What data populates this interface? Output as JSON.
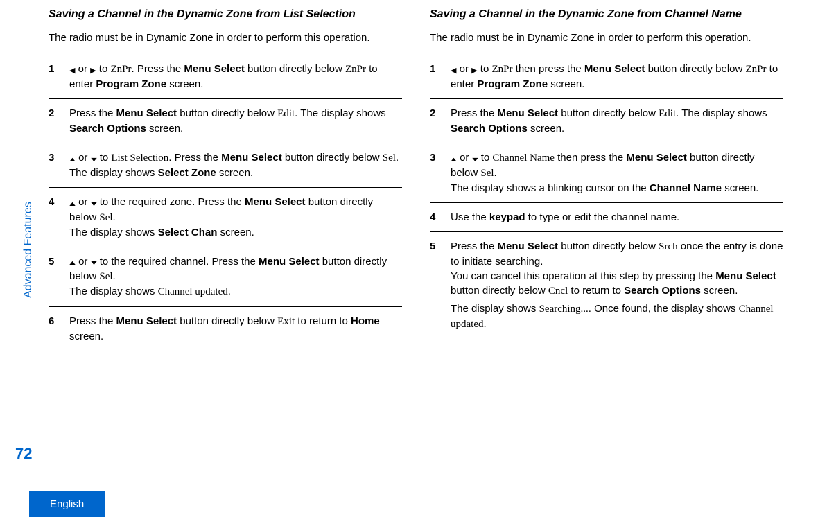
{
  "sidebar": {
    "section_label": "Advanced Features",
    "page_number": "72",
    "language": "English"
  },
  "left": {
    "title": "Saving a Channel in the Dynamic Zone from List Selection",
    "intro": "The radio must be in Dynamic Zone in order to perform this operation.",
    "steps": {
      "s1": {
        "num": "1",
        "html": "<span class='icon arrow-left' data-name='nav-left-icon' data-interactable='false'></span> or <span class='icon arrow-right' data-name='nav-right-icon' data-interactable='false'></span> to <span class='soft'>ZnPr</span>. Press the <span class='b'>Menu Select</span> button directly below <span class='soft'>ZnPr</span> to enter <span class='b'>Program Zone</span> screen."
      },
      "s2": {
        "num": "2",
        "html": "Press the <span class='b'>Menu Select</span> button directly below <span class='soft'>Edit</span>. The display shows <span class='b'>Search Options</span> screen."
      },
      "s3": {
        "num": "3",
        "html": "<span class='icon arrow-up' data-name='nav-up-icon' data-interactable='false'></span> or <span class='icon arrow-down' data-name='nav-down-icon' data-interactable='false'></span> to <span class='soft'>List Selection</span>. Press the <span class='b'>Menu Select</span> button directly below <span class='soft'>Sel</span>.<br>The display shows <span class='b'>Select Zone</span> screen."
      },
      "s4": {
        "num": "4",
        "html": "<span class='icon arrow-up' data-name='nav-up-icon' data-interactable='false'></span> or <span class='icon arrow-down' data-name='nav-down-icon' data-interactable='false'></span> to the required zone. Press the <span class='b'>Menu Select</span> button directly below <span class='soft'>Sel</span>.<br>The display shows <span class='b'>Select Chan</span> screen."
      },
      "s5": {
        "num": "5",
        "html": "<span class='icon arrow-up' data-name='nav-up-icon' data-interactable='false'></span> or <span class='icon arrow-down' data-name='nav-down-icon' data-interactable='false'></span> to the required channel. Press the <span class='b'>Menu Select</span> button directly below <span class='soft'>Sel</span>.<br>The display shows <span class='soft'>Channel updated</span>."
      },
      "s6": {
        "num": "6",
        "html": "Press the <span class='b'>Menu Select</span> button directly below <span class='soft'>Exit</span> to return to <span class='b'>Home</span> screen."
      }
    }
  },
  "right": {
    "title": "Saving a Channel in the Dynamic Zone from Channel Name",
    "intro": "The radio must be in Dynamic Zone in order to perform this operation.",
    "steps": {
      "s1": {
        "num": "1",
        "html": "<span class='icon arrow-left' data-name='nav-left-icon' data-interactable='false'></span> or <span class='icon arrow-right' data-name='nav-right-icon' data-interactable='false'></span> to <span class='soft'>ZnPr</span> then press the <span class='b'>Menu Select</span> button directly below <span class='soft'>ZnPr</span> to enter <span class='b'>Program Zone</span> screen."
      },
      "s2": {
        "num": "2",
        "html": "Press the <span class='b'>Menu Select</span> button directly below <span class='soft'>Edit</span>. The display shows <span class='b'>Search Options</span> screen."
      },
      "s3": {
        "num": "3",
        "html": "<span class='icon arrow-up' data-name='nav-up-icon' data-interactable='false'></span> or <span class='icon arrow-down' data-name='nav-down-icon' data-interactable='false'></span> to <span class='soft'>Channel Name</span> then press the <span class='b'>Menu Select</span> button directly below <span class='soft'>Sel</span>.<br>The display shows a blinking cursor on the <span class='b'>Channel Name</span> screen."
      },
      "s4": {
        "num": "4",
        "html": "Use the <span class='b'>keypad</span> to type or edit the channel name."
      },
      "s5": {
        "num": "5",
        "html": "Press the <span class='b'>Menu Select</span> button directly below <span class='soft'>Srch</span> once the entry is done to initiate searching.<p>You can cancel this operation at this step by pressing the <span class='b'>Menu Select</span> button directly below <span class='soft'>Cncl</span> to return to <span class='b'>Search Options</span> screen.</p><p>The display shows <span class='soft'>Searching...</span>. Once found, the display shows <span class='soft'>Channel updated</span>.</p>"
      }
    }
  }
}
